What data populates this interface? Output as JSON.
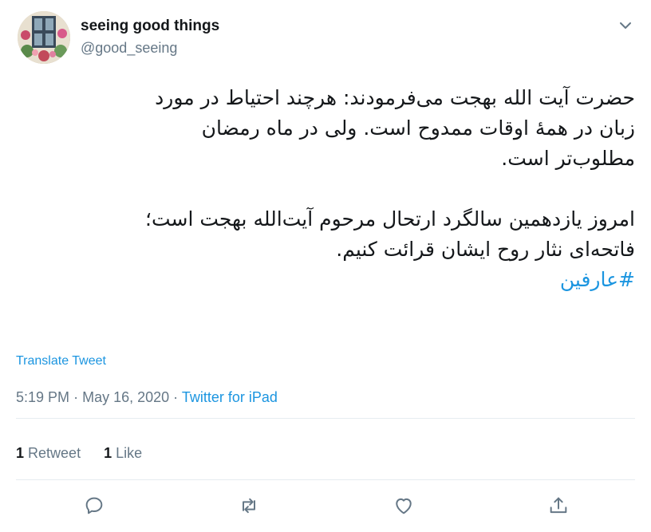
{
  "author": {
    "display_name": "seeing good things",
    "username": "@good_seeing"
  },
  "tweet": {
    "paragraph1_lines": [
      "حضرت آیت الله بهجت می‌فرمودند: هرچند احتیاط در مورد",
      "زبان در همهٔ اوقات ممدوح است. ولی در ماه رمضان",
      "مطلوب‌تر است."
    ],
    "paragraph2_lines": [
      "امروز یازدهمین سالگرد ارتحال مرحوم آیت‌الله بهجت است؛",
      "فاتحه‌ای نثار روح ایشان قرائت کنیم."
    ],
    "hashtag": "#عارفین"
  },
  "translate_label": "Translate Tweet",
  "meta": {
    "time": "5:19 PM",
    "separator": "·",
    "date": "May 16, 2020",
    "source": "Twitter for iPad"
  },
  "stats": {
    "retweet_count": "1",
    "retweet_label": "Retweet",
    "like_count": "1",
    "like_label": "Like"
  },
  "icons": {
    "caret": "chevron-down-icon",
    "reply": "reply-icon",
    "retweet": "retweet-icon",
    "like": "heart-icon",
    "share": "share-icon"
  },
  "colors": {
    "link": "#1b95e0",
    "secondary_text": "#657786",
    "primary_text": "#14171a",
    "divider": "#e6ecf0"
  }
}
